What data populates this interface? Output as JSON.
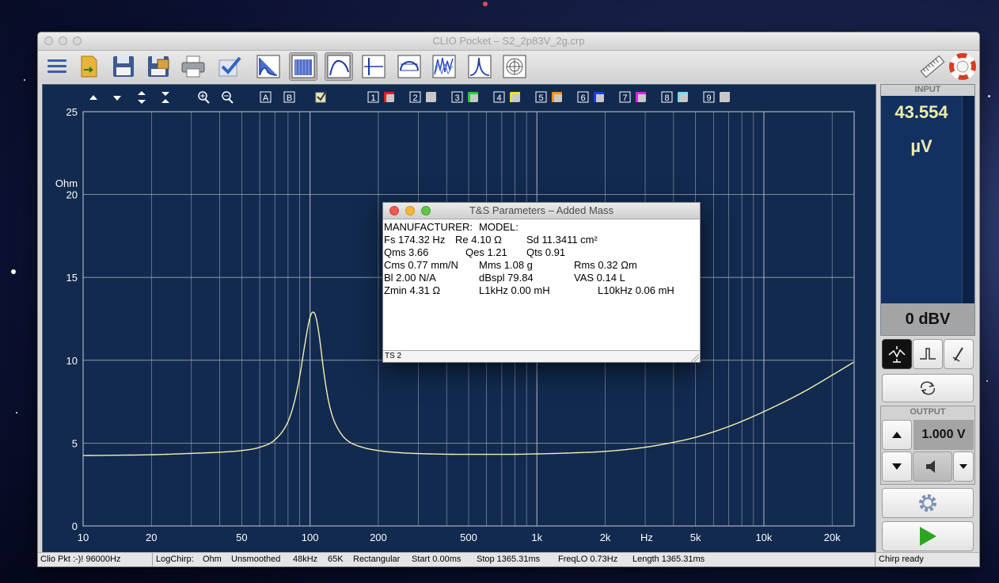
{
  "window": {
    "title": "CLIO Pocket – S2_2p83V_2g.crp"
  },
  "toolbar": {
    "buttons": [
      {
        "name": "menu-button",
        "icon": "hamburger-icon"
      },
      {
        "name": "open-file-button",
        "icon": "open-folder-icon"
      },
      {
        "name": "save-button",
        "icon": "floppy-disk-icon"
      },
      {
        "name": "save-as-button",
        "icon": "floppy-image-icon"
      },
      {
        "name": "print-button",
        "icon": "printer-icon"
      },
      {
        "name": "check-button",
        "icon": "checkmark-icon"
      },
      {
        "name": "fft-button",
        "icon": "fft-graph-icon"
      },
      {
        "name": "sinusoidal-button",
        "icon": "sinusoidal-graph-icon"
      },
      {
        "name": "impedance-button",
        "icon": "impedance-graph-icon"
      },
      {
        "name": "impulse-button",
        "icon": "impulse-graph-icon"
      },
      {
        "name": "meter-button",
        "icon": "meter-graph-icon"
      },
      {
        "name": "waterfall-button",
        "icon": "waterfall-graph-icon"
      },
      {
        "name": "resonance-button",
        "icon": "resonance-graph-icon"
      },
      {
        "name": "polar-button",
        "icon": "polar-graph-icon"
      },
      {
        "name": "ruler-button",
        "icon": "ruler-icon"
      },
      {
        "name": "help-button",
        "icon": "lifebuoy-icon"
      }
    ]
  },
  "plot_toolbar": {
    "marker_labels": [
      "A",
      "B"
    ],
    "memory_slots": [
      {
        "label": "1",
        "color": "#e02020"
      },
      {
        "label": "2",
        "color": "#c8c8c8"
      },
      {
        "label": "3",
        "color": "#22d022"
      },
      {
        "label": "4",
        "color": "#f0e020"
      },
      {
        "label": "5",
        "color": "#ff8c1a"
      },
      {
        "label": "6",
        "color": "#1a3cf0"
      },
      {
        "label": "7",
        "color": "#e020e0"
      },
      {
        "label": "8",
        "color": "#70e0f0"
      },
      {
        "label": "9",
        "color": "#c8c8c8"
      }
    ]
  },
  "chart_data": {
    "type": "line",
    "ylabel": "Ohm",
    "xlabel": "Hz",
    "x_scale": "log",
    "xlim": [
      10,
      25000
    ],
    "ylim": [
      0,
      25
    ],
    "y_ticks": [
      "0",
      "5",
      "10",
      "15",
      "20",
      "25"
    ],
    "x_ticks": [
      {
        "value": 10,
        "label": "10"
      },
      {
        "value": 20,
        "label": "20"
      },
      {
        "value": 50,
        "label": "50"
      },
      {
        "value": 100,
        "label": "100"
      },
      {
        "value": 200,
        "label": "200"
      },
      {
        "value": 500,
        "label": "500"
      },
      {
        "value": 1000,
        "label": "1k"
      },
      {
        "value": 2000,
        "label": "2k"
      },
      {
        "value": 5000,
        "label": "5k"
      },
      {
        "value": 10000,
        "label": "10k"
      },
      {
        "value": 20000,
        "label": "20k"
      }
    ],
    "grid": true,
    "line_color": "#f4f0b0",
    "series": [
      {
        "x": [
          10,
          20,
          30,
          40,
          50,
          60,
          70,
          80,
          85,
          90,
          95,
          100,
          103,
          105,
          107,
          110,
          115,
          120,
          125,
          130,
          140,
          150,
          170,
          200,
          250,
          300,
          400,
          500,
          700,
          1000,
          1500,
          2000,
          3000,
          4000,
          5000,
          7000,
          10000,
          15000,
          20000,
          25000
        ],
        "y": [
          4.25,
          4.3,
          4.38,
          4.45,
          4.55,
          4.75,
          5.2,
          6.3,
          7.4,
          9.0,
          11.0,
          12.6,
          12.9,
          12.8,
          12.4,
          11.4,
          9.3,
          7.7,
          6.7,
          6.1,
          5.4,
          5.05,
          4.75,
          4.55,
          4.42,
          4.37,
          4.33,
          4.32,
          4.32,
          4.35,
          4.42,
          4.5,
          4.75,
          5.05,
          5.35,
          6.0,
          6.9,
          8.1,
          9.1,
          9.9
        ]
      }
    ]
  },
  "input_panel": {
    "header": "INPUT",
    "value": "43.554",
    "unit": "µV",
    "level": "0 dBV"
  },
  "output_panel": {
    "header": "OUTPUT",
    "value": "1.000 V"
  },
  "statusbar": {
    "device": "Clio Pkt :-)! 96000Hz",
    "mode": "LogChirp:",
    "unit": "Ohm",
    "smoothing": "Unsmoothed",
    "rate": "48kHz",
    "size": "65K",
    "window": "Rectangular",
    "start": "Start 0.00ms",
    "stop": "Stop 1365.31ms",
    "freqlo": "FreqLO 0.73Hz",
    "length": "Length 1365.31ms",
    "state": "Chirp ready"
  },
  "ts_dialog": {
    "title": "T&S Parameters – Added Mass",
    "manufacturer": "MANUFACTURER:",
    "model": "MODEL:",
    "fs": "Fs  174.32 Hz",
    "re": "Re  4.10 Ω",
    "sd": "Sd  11.3411 cm²",
    "qms": "Qms 3.66",
    "qes": "Qes 1.21",
    "qts": "Qts 0.91",
    "cms": "Cms 0.77 mm/N",
    "mms": "Mms 1.08 g",
    "rms": "Rms 0.32 Ωm",
    "bl": "Bl   2.00 N/A",
    "dbspl": "dBspl 79.84",
    "vas": "VAS  0.14 L",
    "zmin": "Zmin   4.31 Ω",
    "l1khz": "L1kHz  0.00 mH",
    "l10khz": "L10kHz 0.06 mH",
    "footer": "TS 2"
  }
}
